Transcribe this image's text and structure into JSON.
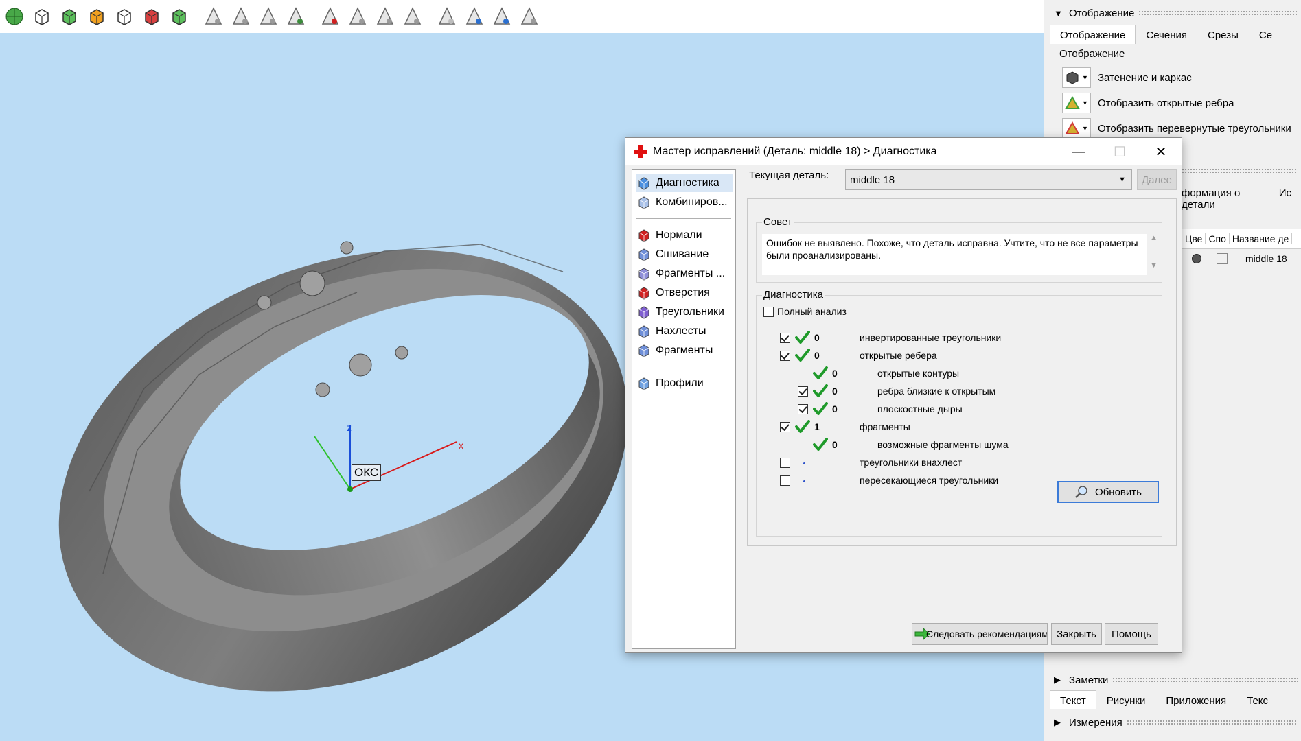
{
  "toolbar": {
    "icons": [
      "flower-icon",
      "cube-select-icon",
      "cube-green-icon",
      "cube-orange-icon",
      "cube-wire-icon",
      "cube-red-icon",
      "cube-split-icon",
      "triangle-select-icon",
      "triangle-edit-icon",
      "triangle-pen-icon",
      "triangle-move-icon",
      "triangle-delete-icon",
      "triangle-grid-icon",
      "triangle-doc-icon",
      "triangle-flat-icon",
      "triangle-outline-icon",
      "triangle-wave-icon",
      "triangle-blue-icon",
      "triangle-fill-icon"
    ]
  },
  "viewport": {
    "axis_x": "x",
    "axis_z": "z",
    "oks_label": "ОКС"
  },
  "right_panel": {
    "display_section": "Отображение",
    "tabs": [
      "Отображение",
      "Сечения",
      "Срезы",
      "Се"
    ],
    "group_title": "Отображение",
    "display_rows": [
      {
        "label": "Затенение и каркас",
        "icon": "shaded-cube-icon"
      },
      {
        "label": "Отобразить открытые ребра",
        "icon": "open-edges-icon"
      },
      {
        "label": "Отобразить перевернутые треугольники",
        "icon": "flipped-triangles-icon"
      }
    ],
    "info_tabs": [
      "формация о детали",
      "Ис"
    ],
    "info_columns": [
      "Цве",
      "Спо",
      "Название де"
    ],
    "info_row_name": "middle 18",
    "notes_section": "Заметки",
    "notes_tabs": [
      "Текст",
      "Рисунки",
      "Приложения",
      "Текс"
    ],
    "measure_section": "Измерения"
  },
  "dialog": {
    "title": "Мастер исправлений (Деталь: middle 18) > Диагностика",
    "nav": {
      "top": [
        {
          "label": "Диагностика",
          "selected": true,
          "icon": "magnifier-icon"
        },
        {
          "label": "Комбиниров...",
          "icon": "combine-icon"
        }
      ],
      "middle": [
        {
          "label": "Нормали",
          "icon": "normals-icon"
        },
        {
          "label": "Сшивание",
          "icon": "stitch-icon"
        },
        {
          "label": "Фрагменты ...",
          "icon": "shells-icon"
        },
        {
          "label": "Отверстия",
          "icon": "holes-icon"
        },
        {
          "label": "Треугольники",
          "icon": "triangles-icon"
        },
        {
          "label": "Нахлесты",
          "icon": "overlaps-icon"
        },
        {
          "label": "Фрагменты",
          "icon": "fragments-icon"
        }
      ],
      "bottom": [
        {
          "label": "Профили",
          "icon": "profiles-icon"
        }
      ]
    },
    "current_part_label": "Текущая деталь:",
    "current_part_value": "middle 18",
    "next_button": "Далее",
    "tip_title": "Совет",
    "tip_text": "Ошибок не выявлено. Похоже, что деталь исправна. Учтите, что не все параметры были проанализированы.",
    "diag_title": "Диагностика",
    "full_analysis_label": "Полный анализ",
    "diag_rows": [
      {
        "label": "инвертированные треугольники",
        "count": "0",
        "checked": true,
        "indent": false,
        "status": "ok"
      },
      {
        "label": "открытые ребера",
        "count": "0",
        "checked": true,
        "indent": false,
        "status": "ok"
      },
      {
        "label": "открытые контуры",
        "count": "0",
        "checked": null,
        "indent": true,
        "status": "ok"
      },
      {
        "label": "ребра близкие к открытым",
        "count": "0",
        "checked": true,
        "indent": true,
        "status": "ok"
      },
      {
        "label": "плоскостные дыры",
        "count": "0",
        "checked": true,
        "indent": true,
        "status": "ok"
      },
      {
        "label": "фрагменты",
        "count": "1",
        "checked": true,
        "indent": false,
        "status": "ok"
      },
      {
        "label": "возможные фрагменты шума",
        "count": "0",
        "checked": null,
        "indent": true,
        "status": "ok"
      },
      {
        "label": "треугольники внахлест",
        "count": "",
        "checked": false,
        "indent": false,
        "status": "dot"
      },
      {
        "label": "пересекающиеся треугольники",
        "count": "",
        "checked": false,
        "indent": false,
        "status": "dot"
      }
    ],
    "refresh_button": "Обновить",
    "follow_button": "Следовать рекомендациям",
    "close_button": "Закрыть",
    "help_button": "Помощь"
  }
}
